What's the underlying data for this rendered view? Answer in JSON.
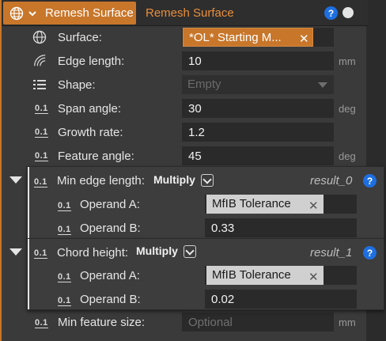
{
  "header": {
    "title": "Remesh Surface",
    "subtitle": "Remesh Surface",
    "help": "?"
  },
  "rows": {
    "surface": {
      "label": "Surface:",
      "tag": "*OL* Starting M...",
      "remove": "✕"
    },
    "edge_length": {
      "label": "Edge length:",
      "value": "10",
      "unit": "mm"
    },
    "shape": {
      "label": "Shape:",
      "value": "Empty"
    },
    "span_angle": {
      "label": "Span angle:",
      "value": "30",
      "unit": "deg"
    },
    "growth_rate": {
      "label": "Growth rate:",
      "value": "1.2"
    },
    "feature_angle": {
      "label": "Feature angle:",
      "value": "45",
      "unit": "deg"
    },
    "min_feature_size": {
      "label": "Min feature size:",
      "placeholder": "Optional",
      "unit": "mm"
    }
  },
  "groups": [
    {
      "label": "Min edge length:",
      "operation": "Multiply",
      "result": "result_0",
      "help": "?",
      "operand_a": {
        "label": "Operand A:",
        "tag": "MfIB Tolerance",
        "remove": "✕"
      },
      "operand_b": {
        "label": "Operand B:",
        "value": "0.33"
      }
    },
    {
      "label": "Chord height:",
      "operation": "Multiply",
      "result": "result_1",
      "help": "?",
      "operand_a": {
        "label": "Operand A:",
        "tag": "MfIB Tolerance",
        "remove": "✕"
      },
      "operand_b": {
        "label": "Operand B:",
        "value": "0.02"
      }
    }
  ],
  "icons": {
    "number": "0.1"
  },
  "colors": {
    "accent": "#c8762a",
    "accent_text": "#e98e3c",
    "help_blue": "#1e6fe0"
  }
}
